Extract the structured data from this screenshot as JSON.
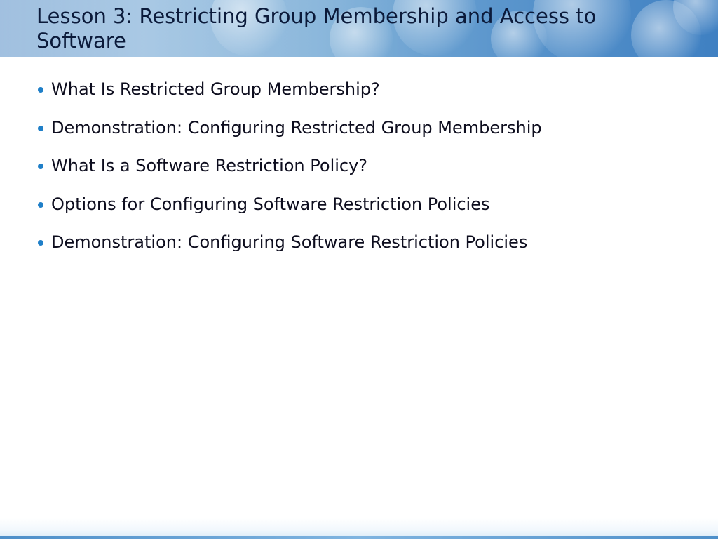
{
  "slide": {
    "title": "Lesson 3: Restricting Group Membership and Access to Software",
    "bullets": [
      "What Is Restricted Group Membership?",
      "Demonstration: Configuring Restricted Group Membership",
      "What Is a Software Restriction Policy?",
      "Options for Configuring Software Restriction Policies",
      "Demonstration: Configuring Software Restriction Policies"
    ]
  },
  "colors": {
    "title_text": "#0b1a3a",
    "body_text": "#0d0d1e",
    "bullet_accent": "#1f7fc8",
    "header_band": "#5a95cc"
  }
}
